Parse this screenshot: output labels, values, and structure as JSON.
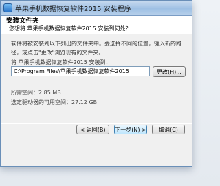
{
  "window": {
    "title": "苹果手机数据恢复软件2015 安装程序"
  },
  "header": {
    "title": "安装文件夹",
    "description": "您想将 苹果手机数据恢复软件2015 安装到何处？"
  },
  "main": {
    "instruction": "软件将被安装到以下列出的文件夹中。要选择不同的位置，键入新的路径，或点击\"更改\"浏览现有的文件夹。",
    "path_label": "将 苹果手机数据恢复软件2015 安装到：",
    "path_value": "C:\\Program Files\\苹果手机数据恢复软件2015",
    "browse_label": "更改(H)...",
    "space_required": "所需空间：2.85 MB",
    "space_available": "选定驱动器的可用空间：27.12 GB"
  },
  "buttons": {
    "back": "< 返回(B)",
    "next": "下一步(N) >",
    "cancel": "取消(C)"
  }
}
